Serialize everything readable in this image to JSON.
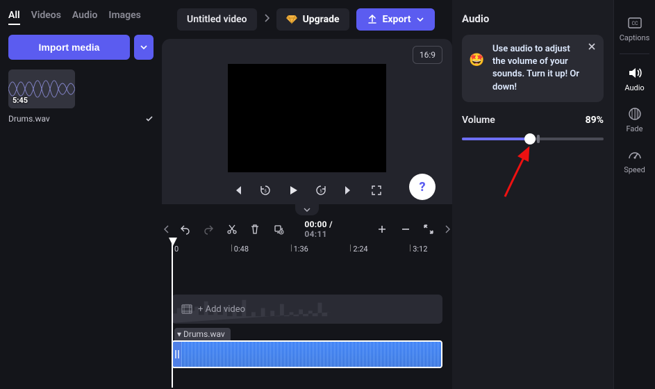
{
  "left": {
    "tabs": [
      "All",
      "Videos",
      "Audio",
      "Images"
    ],
    "activeTab": 0,
    "importLabel": "Import media",
    "media": {
      "name": "Drums.wav",
      "duration": "5:45"
    }
  },
  "topbar": {
    "title": "Untitled video",
    "upgrade": "Upgrade",
    "export": "Export"
  },
  "preview": {
    "aspect": "16:9"
  },
  "toolbar": {
    "current": "00:00",
    "total": "04:11"
  },
  "ruler": [
    "0",
    "0:48",
    "1:36",
    "2:24",
    "3:12"
  ],
  "tracks": {
    "addVideo": "+ Add video",
    "audioClip": "Drums.wav"
  },
  "right": {
    "title": "Audio",
    "tip": "Use audio to adjust the volume of your sounds. Turn it up! Or down!",
    "volumeLabel": "Volume",
    "volumeValue": "89%",
    "volumePercent": 48,
    "tickPercent": 53
  },
  "rail": [
    {
      "label": "Captions"
    },
    {
      "label": "Audio"
    },
    {
      "label": "Fade"
    },
    {
      "label": "Speed"
    }
  ]
}
